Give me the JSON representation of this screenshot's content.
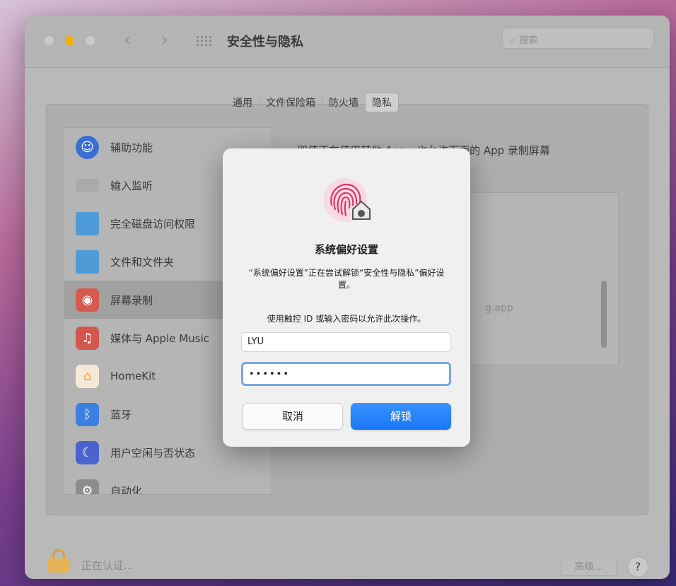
{
  "window": {
    "title": "安全性与隐私",
    "search_placeholder": "搜索"
  },
  "tabs": [
    {
      "label": "通用"
    },
    {
      "label": "文件保险箱"
    },
    {
      "label": "防火墙"
    },
    {
      "label": "隐私"
    }
  ],
  "sidebar": {
    "items": [
      {
        "label": "辅助功能",
        "icon": "accessibility-icon",
        "color": "#3b6fd1"
      },
      {
        "label": "输入监听",
        "icon": "keyboard-icon",
        "color": "#a9a9a9"
      },
      {
        "label": "完全磁盘访问权限",
        "icon": "folder-icon",
        "color": "#4f9bd8"
      },
      {
        "label": "文件和文件夹",
        "icon": "folder-icon",
        "color": "#4f9bd8"
      },
      {
        "label": "屏幕录制",
        "icon": "screen-record-icon",
        "color": "#d55a4d"
      },
      {
        "label": "媒体与 Apple Music",
        "icon": "music-icon",
        "color": "#d4574f"
      },
      {
        "label": "HomeKit",
        "icon": "home-icon",
        "color": "#e8a23b"
      },
      {
        "label": "蓝牙",
        "icon": "bluetooth-icon",
        "color": "#3b7fe0"
      },
      {
        "label": "用户空闲与否状态",
        "icon": "moon-icon",
        "color": "#4a63cf"
      },
      {
        "label": "自动化",
        "icon": "gear-icon",
        "color": "#8d8d8d"
      }
    ]
  },
  "right_panel": {
    "description": "即使正在使用其他 App，也允许下面的 App 录制屏幕",
    "partial_app": "g.app"
  },
  "bottom": {
    "status": "正在认证...",
    "advanced": "高级...",
    "help": "?"
  },
  "dialog": {
    "title": "系统偏好设置",
    "message": "“系统偏好设置”正在尝试解锁“安全性与隐私”偏好设置。",
    "prompt": "使用触控 ID 或输入密码以允许此次操作。",
    "username": "LYU",
    "password_mask": "••••••",
    "cancel": "取消",
    "unlock": "解锁"
  }
}
